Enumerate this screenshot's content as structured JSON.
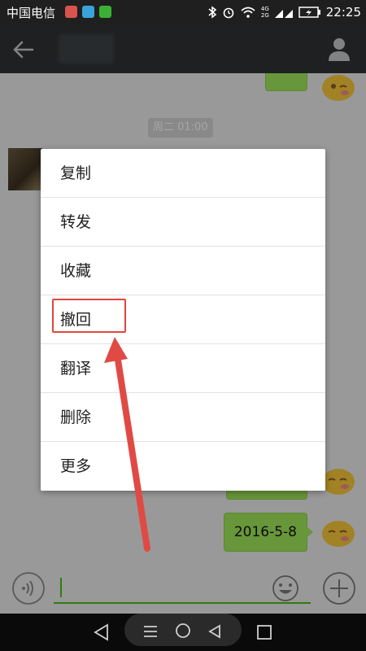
{
  "status_bar": {
    "carrier": "中国电信",
    "network_4g": "4G",
    "network_2g": "2G",
    "time": "22:25"
  },
  "chat": {
    "time_divider": "周二 01:00",
    "date_message": "2016-5-8"
  },
  "context_menu": {
    "items": [
      {
        "label": "复制"
      },
      {
        "label": "转发"
      },
      {
        "label": "收藏"
      },
      {
        "label": "撤回"
      },
      {
        "label": "翻译"
      },
      {
        "label": "删除"
      },
      {
        "label": "更多"
      }
    ]
  },
  "colors": {
    "bubble_green": "#a0e75a",
    "annotation_red": "#e0463f",
    "input_accent": "#45c01a",
    "header_bg": "#2f3235"
  },
  "icons": [
    "back-arrow-icon",
    "profile-icon",
    "voice-icon",
    "emoji-icon",
    "plus-icon",
    "nav-back-icon",
    "nav-home-icon",
    "nav-recent-icon",
    "nav-menu-icon"
  ]
}
